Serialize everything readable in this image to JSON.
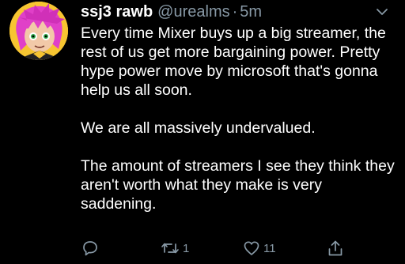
{
  "tweet": {
    "display_name": "ssj3 rawb",
    "handle": "@urealms",
    "separator": "·",
    "time": "5m",
    "paragraphs": [
      "Every time Mixer buys up a big streamer, the rest of us get more bargaining power. Pretty hype power move by microsoft that's gonna help us all soon.",
      "We are all massively undervalued.",
      "The amount of streamers I see they think they aren't worth what they make is very saddening."
    ]
  },
  "actions": {
    "reply_icon": "reply-icon",
    "retweet_icon": "retweet-icon",
    "retweet_count": "1",
    "like_icon": "heart-icon",
    "like_count": "11",
    "share_icon": "share-icon"
  },
  "colors": {
    "background": "#000000",
    "text": "#ffffff",
    "muted": "#8899a6",
    "avatar_ring": "#f7c531",
    "avatar_hair": "#e040c8"
  }
}
